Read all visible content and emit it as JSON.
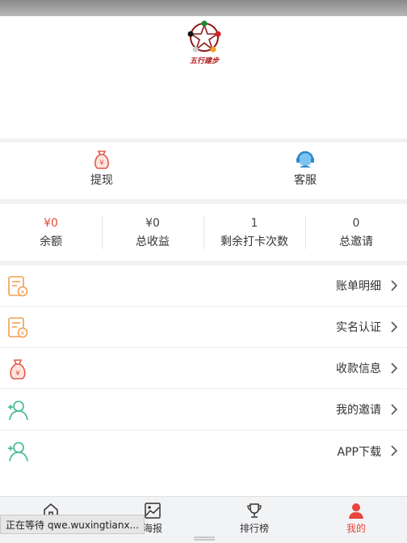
{
  "brand": {
    "logo_text": "五行建步"
  },
  "quick_actions": [
    {
      "label": "提现",
      "icon": "money-bag-icon"
    },
    {
      "label": "客服",
      "icon": "customer-service-icon"
    }
  ],
  "stats": [
    {
      "value": "¥0",
      "caption": "余额"
    },
    {
      "value": "¥0",
      "caption": "总收益"
    },
    {
      "value": "1",
      "caption": "剩余打卡次数"
    },
    {
      "value": "0",
      "caption": "总邀请"
    }
  ],
  "menu": [
    {
      "label": "账单明细",
      "icon": "bill-icon"
    },
    {
      "label": "实名认证",
      "icon": "id-verify-icon"
    },
    {
      "label": "收款信息",
      "icon": "payment-info-icon"
    },
    {
      "label": "我的邀请",
      "icon": "invite-user-icon"
    },
    {
      "label": "APP下载",
      "icon": "download-user-icon"
    }
  ],
  "tabs": [
    {
      "label": "",
      "icon": "home-icon"
    },
    {
      "label": "海报",
      "icon": "poster-icon"
    },
    {
      "label": "排行榜",
      "icon": "trophy-icon"
    },
    {
      "label": "我的",
      "icon": "profile-icon",
      "active": true
    }
  ],
  "status_popup": "正在等待 qwe.wuxingtianx...",
  "colors": {
    "accent": "#e8453c",
    "menu_icon_orange": "#f0a050",
    "menu_icon_green": "#3cb88a",
    "money_icon": "#e05a4a",
    "service_icon": "#3aa0e0"
  }
}
